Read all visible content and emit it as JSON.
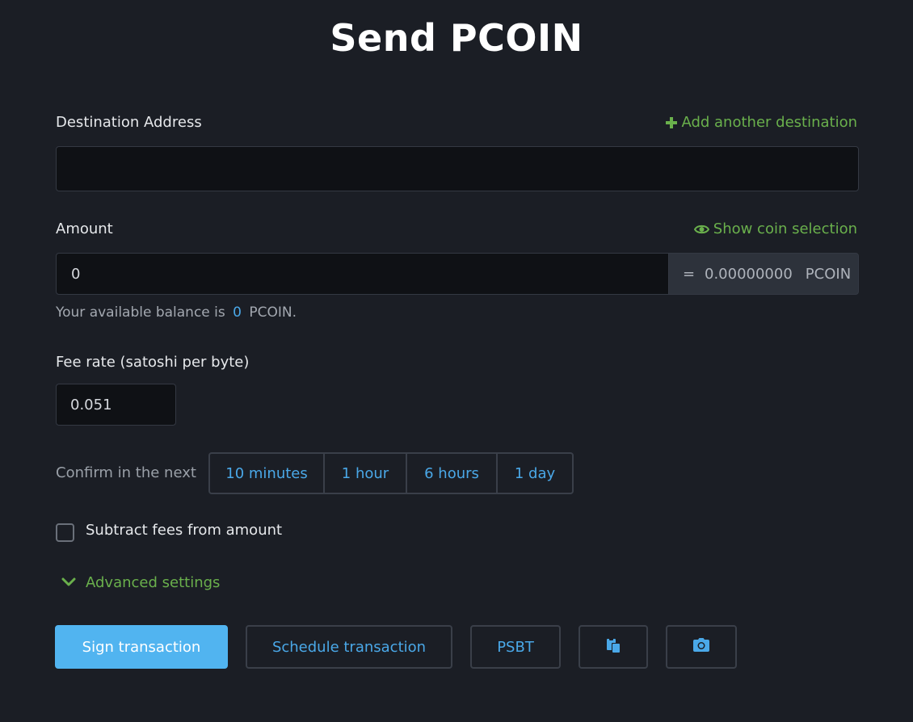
{
  "page": {
    "title": "Send PCOIN"
  },
  "destination": {
    "label": "Destination Address",
    "add_link": "Add another destination",
    "value": ""
  },
  "amount": {
    "label": "Amount",
    "coin_selection_link": "Show coin selection",
    "value": "0",
    "equals": "=",
    "converted": "0.00000000",
    "unit": "PCOIN"
  },
  "balance": {
    "prefix": "Your available balance is",
    "value": "0",
    "suffix": "PCOIN."
  },
  "fee": {
    "label": "Fee rate (satoshi per byte)",
    "value": "0.051"
  },
  "confirm": {
    "label": "Confirm in the next",
    "options": [
      "10 minutes",
      "1 hour",
      "6 hours",
      "1 day"
    ]
  },
  "subtract_fees": {
    "label": "Subtract fees from amount",
    "checked": false
  },
  "advanced": {
    "label": "Advanced settings"
  },
  "actions": {
    "sign": "Sign transaction",
    "schedule": "Schedule transaction",
    "psbt": "PSBT",
    "paste_icon": "paste-icon",
    "camera_icon": "camera-icon"
  },
  "colors": {
    "background": "#1b1e25",
    "green": "#6ab04c",
    "blue": "#4aa8e8",
    "primary_button": "#51b4f0"
  }
}
